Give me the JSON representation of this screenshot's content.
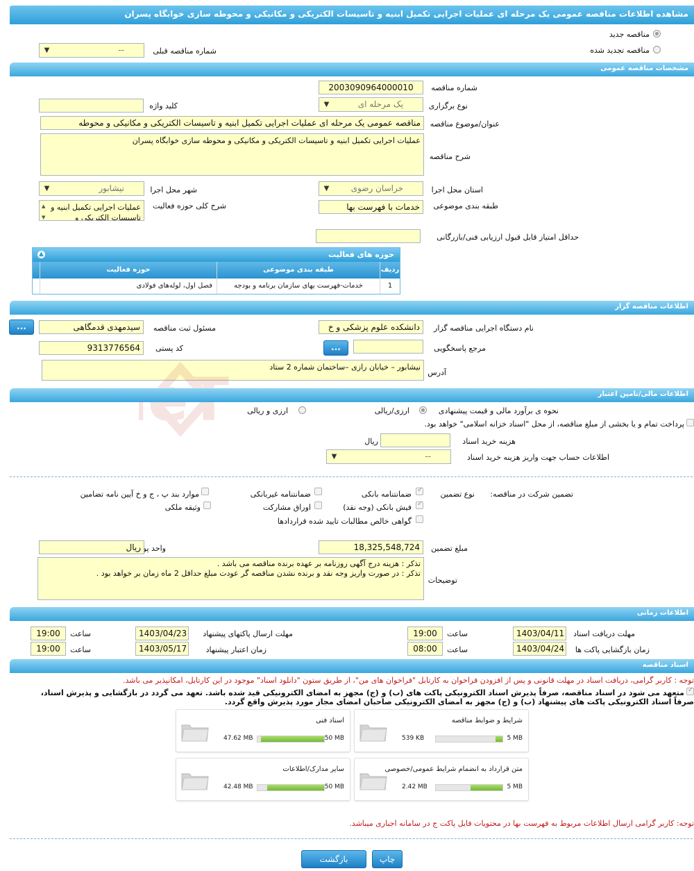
{
  "title": "مشاهده اطلاعات مناقصه عمومی یک مرحله ای عملیات اجرایی تکمیل ابنیه و تاسیسات الکتریکی و مکانیکی و محوطه سازی خوابگاه پسران",
  "tender_type": {
    "new_label": "مناقصه جدید",
    "renewed_label": "مناقصه تجدید شده",
    "prev_number_label": "شماره مناقصه قبلی",
    "prev_number_value": "--"
  },
  "general": {
    "section_title": "مشخصات مناقصه عمومی",
    "number_label": "شماره مناقصه",
    "number_value": "2003090964000010",
    "holding_type_label": "نوع برگزاری",
    "holding_type_value": "یک مرحله ای",
    "keyword_label": "کلید واژه",
    "keyword_value": "",
    "subject_label": "عنوان/موضوع مناقصه",
    "subject_value": "مناقصه عمومی یک مرحله ای عملیات اجرایی تکمیل ابنیه و تاسیسات الکتریکی و مکانیکی و محوطه",
    "description_label": "شرح مناقصه",
    "description_value": "عملیات اجرایی تکمیل ابنیه و تاسیسات الکتریکی و مکانیکی و محوطه سازی خوابگاه پسران",
    "province_label": "استان محل اجرا",
    "province_value": "خراسان رضوی",
    "city_label": "شهر محل اجرا",
    "city_value": "نیشابور",
    "category_label": "طبقه بندی موضوعی",
    "category_value": "خدمات با فهرست بها",
    "activity_desc_label": "شرح کلی حوزه فعالیت",
    "activity_desc_value": "عملیات اجرایی تکمیل ابنیه و تاسیسات الکتریکی و",
    "min_score_label": "حداقل امتیاز قابل قبول ارزیابی فنی/بازرگانی",
    "min_score_value": ""
  },
  "activity_table": {
    "title": "حوزه های فعالیت",
    "col_row": "ردیف",
    "col_category": "طبقه بندی موضوعی",
    "col_field": "حوزه فعالیت",
    "rows": [
      {
        "row": "1",
        "category": "خدمات-فهرست بهای سازمان برنامه و بودجه",
        "field": "فصل اول، لوله‌های فولادی"
      }
    ]
  },
  "organizer": {
    "section_title": "اطلاعات مناقصه گزار",
    "org_label": "نام دستگاه اجرایی مناقصه گزار",
    "org_value": "دانشکده علوم پزشکی و خ",
    "registrar_label": "مسئول ثبت مناقصه",
    "registrar_value": "سیدمهدی قدمگاهی",
    "dots": "...",
    "ref_label": "مرجع پاسخگویی",
    "ref_value": "",
    "postal_label": "کد پستی",
    "postal_value": "9313776564",
    "address_label": "آدرس",
    "address_value": "نیشابور – خیابان رازی –ساختمان شماره 2 ستاد"
  },
  "finance": {
    "section_title": "اطلاعات مالی/تامین اعتبار",
    "estimate_label": "نحوه ی برآورد مالی و قیمت پیشنهادی",
    "opt_currency_rial": "ارزی/ریالی",
    "opt_currency_and_rial": "ارزی و ریالی",
    "treasury_text": "پرداخت تمام و یا بخشی از مبلغ مناقصه، از محل \"اسناد خزانه اسلامی\" خواهد بود.",
    "doc_fee_label": "هزینه خرید اسناد",
    "doc_fee_value": "",
    "doc_fee_unit": "ریال",
    "account_label": "اطلاعات حساب جهت واریز هزینه خرید اسناد",
    "account_value": "--"
  },
  "guarantee": {
    "participation_label": "تضمین شرکت در مناقصه:",
    "type_label": "نوع تضمین",
    "bank_guarantee": "ضمانتنامه بانکی",
    "nonbank_guarantee": "ضمانتنامه غیربانکی",
    "clauses": "موارد بند پ ، ج و خ آیین نامه تضامین",
    "bank_receipt": "فیش بانکی (وجه نقد)",
    "participation_bonds": "اوراق مشارکت",
    "property": "وثیقه ملکی",
    "claims_cert": "گواهی خالص مطالبات تایید شده قراردادها",
    "amount_label": "مبلغ تضمین",
    "amount_value": "18,325,548,724",
    "currency_label": "واحد پول",
    "currency_value": "ریال",
    "notes_label": "توضیحات",
    "notes_line1": "تذکر : هزینه درج آگهی روزنامه بر عهده برنده مناقصه می باشد .",
    "notes_line2": "تذکر : در صورت واریز وجه نقد و برنده نشدن مناقصه گر عودت مبلغ حداقل 2 ماه زمان بر خواهد بود ."
  },
  "timing": {
    "section_title": "اطلاعات زمانی",
    "doc_receive_label": "مهلت دریافت اسناد",
    "doc_receive_date": "1403/04/11",
    "doc_receive_time": "19:00",
    "submit_label": "مهلت ارسال پاکتهای پیشنهاد",
    "submit_date": "1403/04/23",
    "submit_time": "19:00",
    "opening_label": "زمان بازگشایی پاکت ها",
    "opening_date": "1403/04/24",
    "opening_time": "08:00",
    "validity_label": "زمان اعتبار پیشنهاد",
    "validity_date": "1403/05/17",
    "validity_time": "19:00",
    "time_label": "ساعت"
  },
  "documents": {
    "section_title": "اسناد مناقصه",
    "note1": "توجه : کاربر گرامی، دریافت اسناد در مهلت قانونی و پس از افزودن فراخوان به کارتابل \"فراخوان های من\"، از طریق ستون \"دانلود اسناد\" موجود در این کارتابل، امکانپذیر می باشد.",
    "commit1": "متعهد می شود در اسناد مناقصه، صرفاً پذیرش اسناد الکترونیکی پاکت های (ب) و (ج) مجهز به امضای الکترونیکی قید شده باشد. تعهد می گردد در بازگشایی و پذیرش اسناد،",
    "commit2": "صرفاً اسناد الکترونیکی پاکت های پیشنهاد (ب) و (ج) مجهز به امضای الکترونیکی صاحبان امضای مجاز مورد پذیرش واقع گردد.",
    "files": [
      {
        "name": "شرایط و ضوابط مناقصه",
        "max": "5 MB",
        "size": "539 KB",
        "fill": 0.1
      },
      {
        "name": "اسناد فنی",
        "max": "50 MB",
        "size": "47.62 MB",
        "fill": 0.95
      },
      {
        "name": "متن قرارداد به انضمام شرایط عمومی/خصوصی",
        "max": "5 MB",
        "size": "2.42 MB",
        "fill": 0.48
      },
      {
        "name": "سایر مدارک/اطلاعات",
        "max": "50 MB",
        "size": "42.48 MB",
        "fill": 0.85
      }
    ],
    "note2": "توجه: کاربر گرامی ارسال اطلاعات مربوط به فهرست بها در محتویات فایل پاکت ج در سامانه اجباری میباشد."
  },
  "buttons": {
    "print": "چاپ",
    "back": "بازگشت"
  },
  "watermark": "AriaTender.neT",
  "colors": {
    "header_blue": "#2f9fd8",
    "field_yellow": "#ffffc8",
    "note_red": "#c41a1a",
    "progress_green": "#74b838"
  }
}
